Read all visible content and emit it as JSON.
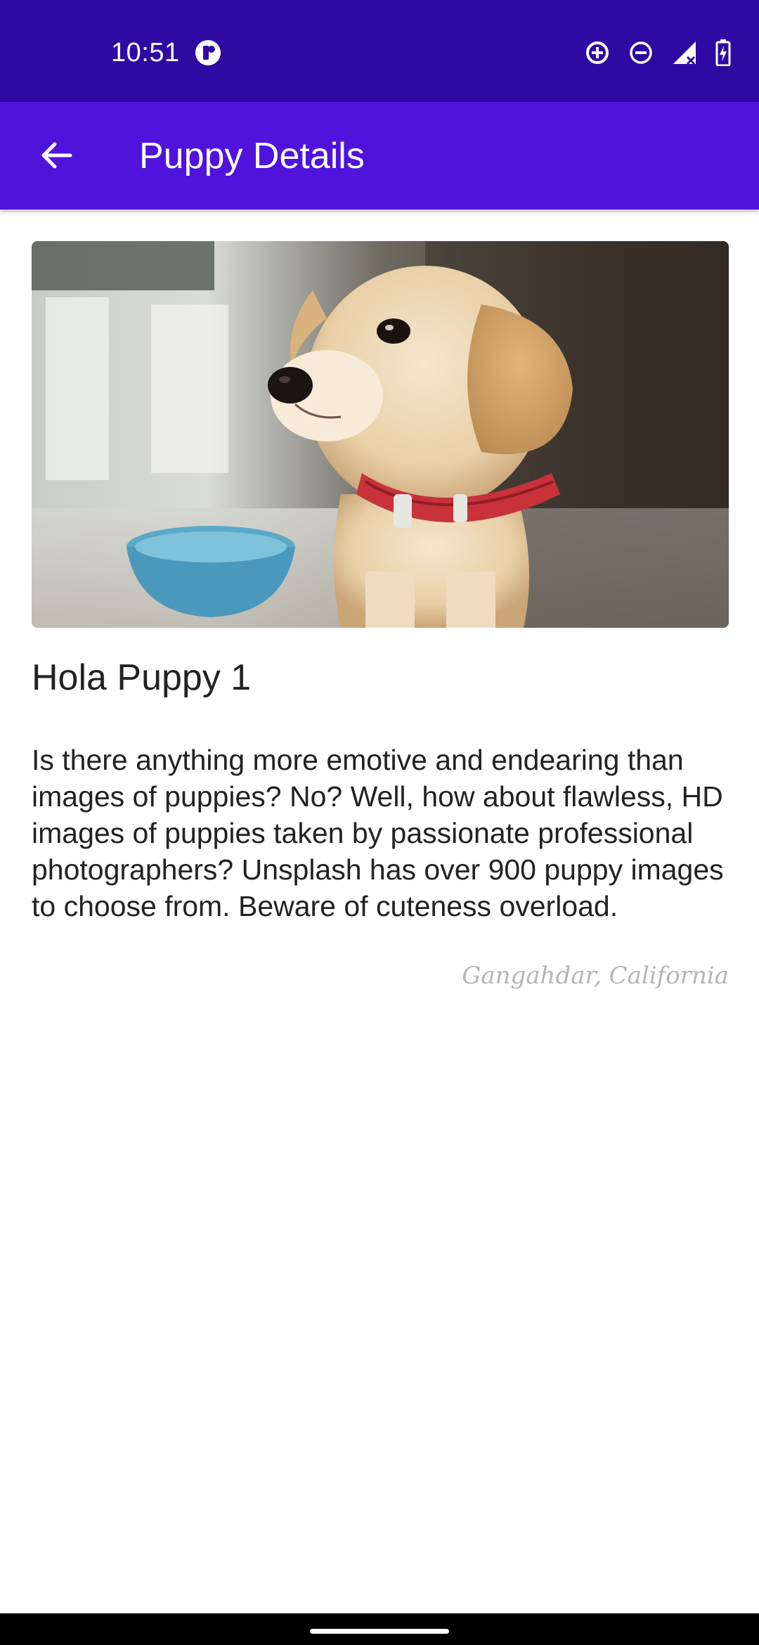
{
  "status_bar": {
    "time": "10:51",
    "icons": [
      "app-notification-icon",
      "data-saver-icon",
      "do-not-disturb-icon",
      "signal-no-connection-icon",
      "battery-charging-icon"
    ],
    "background": "#2e0aa3"
  },
  "app_bar": {
    "title": "Puppy Details",
    "back_icon": "arrow-back-icon",
    "background": "#4f13dc"
  },
  "puppy": {
    "name": "Hola Puppy 1",
    "description": "Is there anything more emotive and endearing than images of puppies? No? Well, how about flawless, HD images of puppies taken by passionate professional photographers? Unsplash has over 900 puppy images to choose from. Beware of cuteness overload.",
    "location": "Gangahdar, California"
  }
}
